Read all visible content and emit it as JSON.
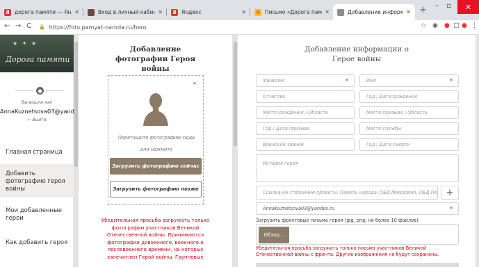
{
  "browser": {
    "tabs": [
      {
        "title": "дорога памяти — Яндекс: нашл",
        "favicon_color": "#e53935",
        "favicon": "Я"
      },
      {
        "title": "Вход в личный кабинет",
        "favicon_color": "#6d4c41",
        "favicon": ""
      },
      {
        "title": "Яндекс",
        "favicon_color": "#e53935",
        "favicon": "Я"
      },
      {
        "title": "Письмо «Дорога памяти» — Ян",
        "favicon_color": "#fbc02d",
        "favicon": "✉"
      },
      {
        "title": "Добавление информации о Ге",
        "favicon_color": "#8d8d8d",
        "favicon": ""
      }
    ],
    "url": "https://foto.pamyat-naroda.ru/hero"
  },
  "sidebar": {
    "logo_text": "Дорога памяти",
    "logged_in_label": "Вы вошли как",
    "username": "AnnaKuznetsova03@yandex",
    "logout_label": "← Выйти",
    "menu": [
      {
        "label": "Главная страница",
        "active": false
      },
      {
        "label": "Добавить фотографию героя войны",
        "active": true
      },
      {
        "label": "Мои добавленные герои",
        "active": false
      },
      {
        "label": "Как добавить героя",
        "active": false
      }
    ]
  },
  "photo_panel": {
    "title": "Добавление фотографии Героя войны",
    "drop_text": "Перетащите фотографию сюда",
    "or_text": "или нажмите",
    "upload_now": "Загрузить фотографию сейчас",
    "upload_later": "Загрузить фотографию позже",
    "warning": "Убедительная просьба загружать только фотографии участников Великой Отечественной войны. Принимаются фотографии довоенного, военного и послевоенного времени, на которых запечатлен Герой войны. Групповые"
  },
  "info_panel": {
    "title": "Добавление информации о Герое войны",
    "fields": {
      "surname": "Фамилия",
      "name": "Имя",
      "patronymic": "Отчество",
      "birth_date": "Год / Дата рождения",
      "birth_place": "Место рождения / Область",
      "draft_place": "Место призыва / Область",
      "draft_year": "Год / Дата призыва",
      "service_place": "Место службы",
      "rank": "Воинское звание",
      "death_date": "Год / Дата смерти",
      "history": "История героя",
      "links": "Ссылка на сторонние проекты: Память народа, ОБД Мемориал, ОБД Подвиг народа",
      "email": "AnnaKuznetsova03@yandex.ru"
    },
    "upload_label": "Загрузить фронтовые письма героя (jpg, png, не более 10 файлов):",
    "browse_label": "Обзор...",
    "warning": "Убедительная просьба загружать только письма участников Великой Отечественной войны с фронта. Другие изображения не будут сохранены."
  }
}
